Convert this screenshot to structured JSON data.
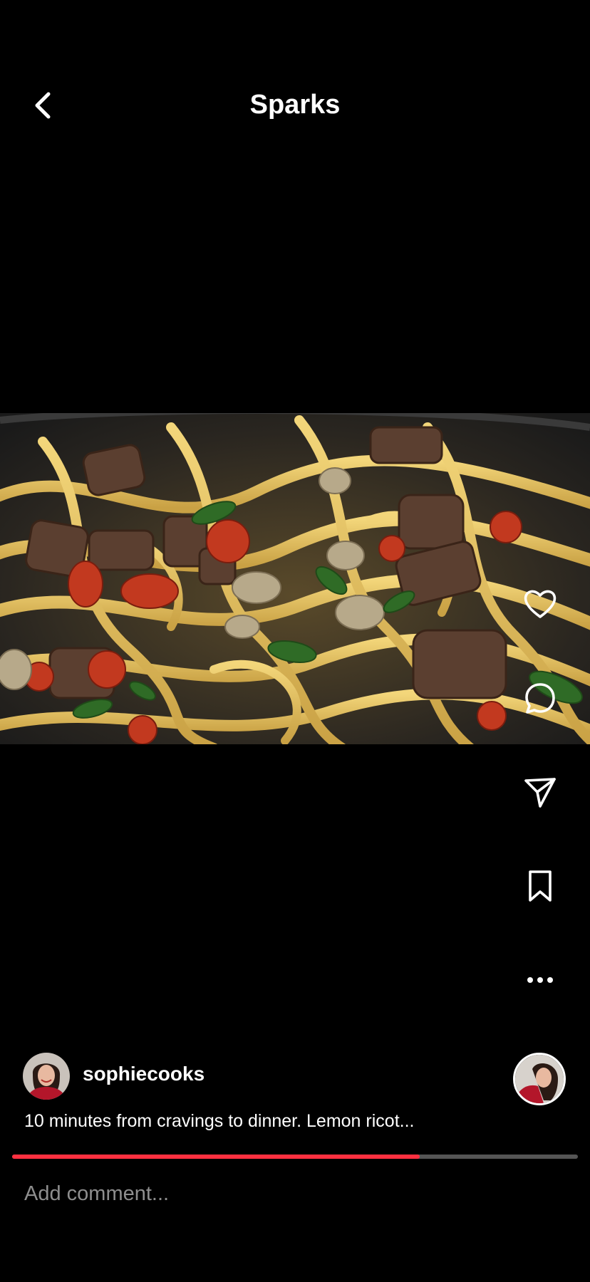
{
  "header": {
    "title": "Sparks",
    "back_icon": "chevron-left-icon"
  },
  "media": {
    "kind": "image",
    "subject": "pasta"
  },
  "actions": [
    {
      "icon": "heart-icon"
    },
    {
      "icon": "comment-icon"
    },
    {
      "icon": "send-icon"
    },
    {
      "icon": "bookmark-icon"
    },
    {
      "icon": "more-icon"
    }
  ],
  "post": {
    "username": "sophiecooks",
    "caption": "10 minutes from cravings to dinner. Lemon ricot...",
    "progress": 0.72
  },
  "comment": {
    "placeholder": "Add comment..."
  },
  "colors": {
    "background": "#000000",
    "progress": "#ff3040",
    "track": "#555555",
    "placeholder": "#8e8e8e"
  }
}
